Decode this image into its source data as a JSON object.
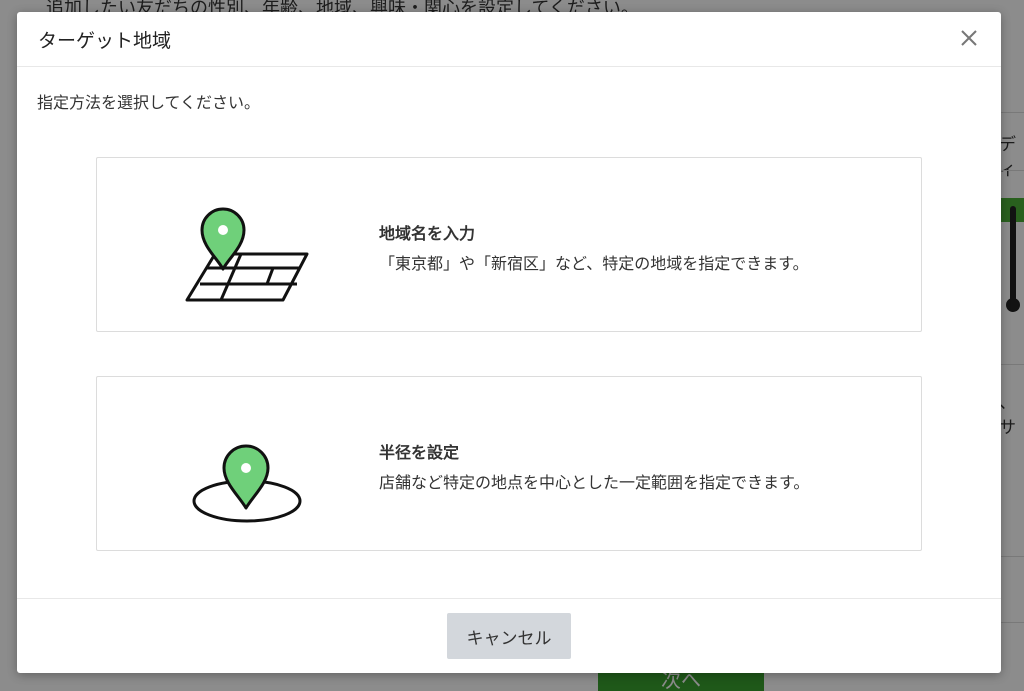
{
  "background": {
    "hint_text": "追加したい友だちの性別、年齢、地域、興味・関心を設定してください。",
    "right_text_1": "ディ",
    "right_text_2": "、サ",
    "next_label": "次へ",
    "accent_color": "#3aa12f"
  },
  "modal": {
    "title": "ターゲット地域",
    "close_icon": "close-icon",
    "instruction": "指定方法を選択してください。",
    "options": [
      {
        "icon": "map-pin-icon",
        "title": "地域名を入力",
        "description": "「東京都」や「新宿区」など、特定の地域を指定できます。"
      },
      {
        "icon": "radius-pin-icon",
        "title": "半径を設定",
        "description": "店舗など特定の地点を中心とした一定範囲を指定できます。"
      }
    ],
    "cancel_label": "キャンセル",
    "pin_color": "#6fd07a"
  }
}
